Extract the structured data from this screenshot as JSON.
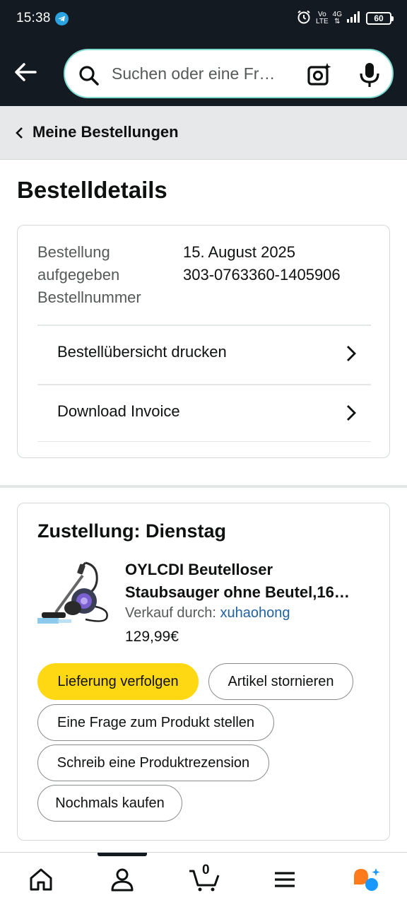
{
  "status_bar": {
    "time": "15:38",
    "net_line1": "Vo",
    "net_line2": "LTE",
    "net_gen": "4G",
    "battery": "60"
  },
  "header": {
    "search_placeholder": "Suchen oder eine Fr…"
  },
  "breadcrumb": {
    "label": "Meine Bestellungen"
  },
  "page": {
    "title": "Bestelldetails"
  },
  "order_info": {
    "label_placed": "Bestellung aufgegeben",
    "label_number": "Bestellnummer",
    "date": "15. August 2025",
    "number": "303-0763360-1405906"
  },
  "actions": {
    "print_summary": "Bestellübersicht drucken",
    "download_invoice": "Download Invoice"
  },
  "delivery": {
    "title": "Zustellung: Dienstag",
    "product_title_line1": "OYLCDI Beutelloser",
    "product_title_line2": "Staubsauger ohne Beutel,16…",
    "seller_prefix": "Verkauf durch: ",
    "seller_name": "xuhaohong",
    "price": "129,99€"
  },
  "buttons": {
    "track": "Lieferung verfolgen",
    "cancel": "Artikel stornieren",
    "question": "Eine Frage zum Produkt stellen",
    "review": "Schreib eine Produktrezension",
    "buy_again": "Nochmals kaufen"
  },
  "bottom_nav": {
    "cart_count": "0",
    "icons": [
      "home-icon",
      "user-icon",
      "cart-icon",
      "menu-icon",
      "ai-assistant-icon"
    ]
  },
  "colors": {
    "header_bg": "#131a22",
    "primary_button": "#ffd814",
    "link": "#2162a1",
    "search_border": "#7fdcd0",
    "ai_orange": "#ff7a1a",
    "ai_blue": "#1a98ff"
  }
}
